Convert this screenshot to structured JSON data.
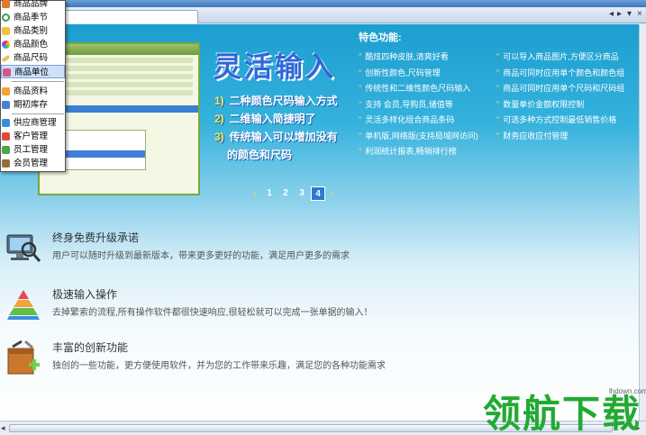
{
  "menu": {
    "items": [
      {
        "label": "商品品牌",
        "icon": "brand-icon"
      },
      {
        "label": "商品季节",
        "icon": "season-icon"
      },
      {
        "label": "商品类别",
        "icon": "category-icon"
      },
      {
        "label": "商品颜色",
        "icon": "color-icon"
      },
      {
        "label": "商品尺码",
        "icon": "size-icon"
      },
      {
        "label": "商品单位",
        "icon": "unit-icon"
      },
      {
        "label": "商品资料",
        "icon": "goods-info-icon"
      },
      {
        "label": "期初库存",
        "icon": "opening-stock-icon"
      },
      {
        "label": "供应商管理",
        "icon": "supplier-icon"
      },
      {
        "label": "客户管理",
        "icon": "customer-icon"
      },
      {
        "label": "员工管理",
        "icon": "staff-icon"
      },
      {
        "label": "会员管理",
        "icon": "member-icon"
      }
    ]
  },
  "banner": {
    "title": "灵活输入",
    "bullets": [
      {
        "num": "1)",
        "text": "二种颜色尺码输入方式"
      },
      {
        "num": "2)",
        "text": "二维输入简捷明了"
      },
      {
        "num": "3)",
        "text": "传统输入可以增加没有"
      },
      {
        "num": "",
        "text": "的颜色和尺码"
      }
    ],
    "features_title": "特色功能:",
    "features_left": [
      "酷炫四种皮肤,清爽好看",
      "创新性颜色,尺码管理",
      "传统性和二维性颜色尺码输入",
      "支持 会员,导购员,储值等",
      "灵活多样化组合商品条码",
      "单机版,网络版(支持局域网访问)",
      "利润统计报表,畅销排行榜"
    ],
    "features_right": [
      "可以导入商品图片,方便区分商品",
      "商品可同时应用单个颜色和颜色组",
      "商品可同时应用单个尺码和尺码组",
      "数量单价金额权限控制",
      "可选多种方式控制最低销售价格",
      "财务应收应付管理"
    ],
    "pager": {
      "prev": "‹",
      "next": "›",
      "pages": [
        "1",
        "2",
        "3",
        "4"
      ],
      "active": "4"
    }
  },
  "promos": [
    {
      "icon": "upgrade-monitor-icon",
      "title": "终身免费升级承诺",
      "desc": "用户可以随时升级到最新版本，带来更多更好的功能，满足用户更多的需求"
    },
    {
      "icon": "speed-pyramid-icon",
      "title": "极速输入操作",
      "desc": "去掉繁索的流程,所有操作软件都很快速响应,很轻松就可以完成一张单据的输入！"
    },
    {
      "icon": "innovation-box-icon",
      "title": "丰富的创新功能",
      "desc": "独创的一些功能，更方便使用软件，并为您的工作带来乐趣，满足您的各种功能需求"
    }
  ],
  "watermark": {
    "logo": "领航下载",
    "url": "lhdown.com"
  },
  "colors": {
    "accent": "#2f67d8",
    "banner_top": "#1c9ed0",
    "pager_active": "#2a7bd0",
    "watermark": "#22aa33"
  }
}
